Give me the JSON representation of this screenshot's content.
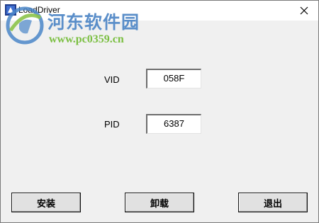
{
  "window": {
    "title": "LoadDriver"
  },
  "watermark": {
    "site_name": "河东软件园",
    "url": "www.pc0359.cn"
  },
  "form": {
    "vid": {
      "label": "VID",
      "value": "058F"
    },
    "pid": {
      "label": "PID",
      "value": "6387"
    }
  },
  "buttons": {
    "install": "安装",
    "uninstall": "卸载",
    "exit": "退出"
  },
  "icons": {
    "app": "app-icon",
    "close": "close-icon"
  }
}
